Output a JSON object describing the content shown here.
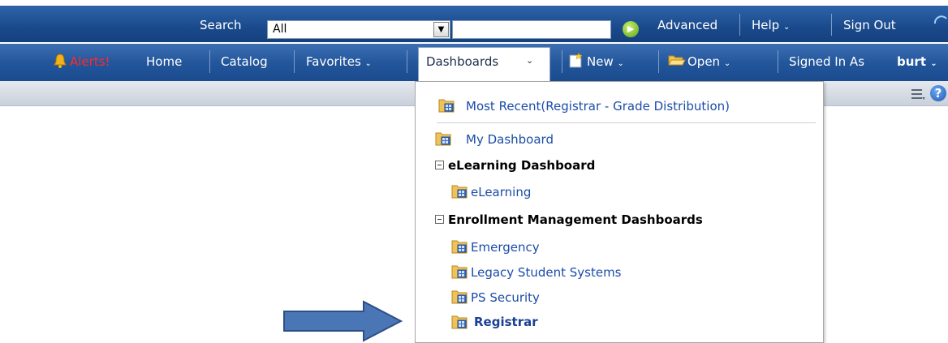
{
  "top_bar": {
    "search_label": "Search",
    "search_scope": "All",
    "search_value": "",
    "advanced_link": "Advanced",
    "help_menu": "Help",
    "sign_out": "Sign Out"
  },
  "nav_bar": {
    "alerts": "Alerts!",
    "home": "Home",
    "catalog": "Catalog",
    "favorites": "Favorites",
    "dashboards": "Dashboards",
    "new": "New",
    "open": "Open",
    "signed_in_label": "Signed In As",
    "user": "burt"
  },
  "dashboards_menu": {
    "most_recent": "Most Recent(Registrar - Grade Distribution)",
    "my_dashboard": "My Dashboard",
    "groups": [
      {
        "title": "eLearning Dashboard",
        "items": [
          "eLearning"
        ]
      },
      {
        "title": "Enrollment Management Dashboards",
        "items": [
          "Emergency",
          "Legacy Student Systems",
          "PS Security",
          "Registrar"
        ]
      }
    ]
  },
  "colors": {
    "header_blue": "#1a4a8c",
    "link_blue": "#1b4ca8",
    "alert_red": "#ff2b2b",
    "arrow_fill": "#4a76b5",
    "arrow_stroke": "#2d4f86"
  }
}
